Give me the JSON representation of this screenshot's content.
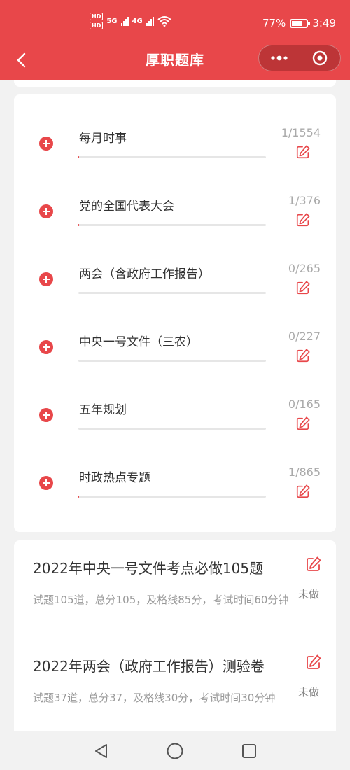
{
  "status_bar": {
    "hd_badges": [
      "HD",
      "HD"
    ],
    "network_1": "5G",
    "network_2": "4G",
    "battery_percent_text": "77%",
    "battery_level": 0.77,
    "time": "3:49",
    "icons": [
      "signal-icon",
      "wifi-icon",
      "battery-icon"
    ]
  },
  "nav": {
    "title": "厚职题库",
    "back_icon": "chevron-left-icon",
    "more_icon": "more-dots-icon",
    "close_icon": "target-close-icon"
  },
  "theme": {
    "accent": "#e8474a",
    "muted": "#aaaaaa"
  },
  "categories": [
    {
      "name": "每月时事",
      "count": "1/1554",
      "progress": 0.0006
    },
    {
      "name": "党的全国代表大会",
      "count": "1/376",
      "progress": 0.0027
    },
    {
      "name": "两会（含政府工作报告）",
      "count": "0/265",
      "progress": 0
    },
    {
      "name": "中央一号文件（三农）",
      "count": "0/227",
      "progress": 0
    },
    {
      "name": "五年规划",
      "count": "0/165",
      "progress": 0
    },
    {
      "name": "时政热点专题",
      "count": "1/865",
      "progress": 0.0012
    }
  ],
  "exams": [
    {
      "title": "2022年中央一号文件考点必做105题",
      "desc": "试题105道，总分105，及格线85分，考试时间60分钟",
      "status": "未做"
    },
    {
      "title": "2022年两会（政府工作报告）测验卷",
      "desc": "试题37道，总分37，及格线30分，考试时间30分钟",
      "status": "未做"
    }
  ],
  "bottom_nav": {
    "back_icon": "triangle-back-icon",
    "home_icon": "circle-home-icon",
    "recent_icon": "square-recent-icon"
  }
}
